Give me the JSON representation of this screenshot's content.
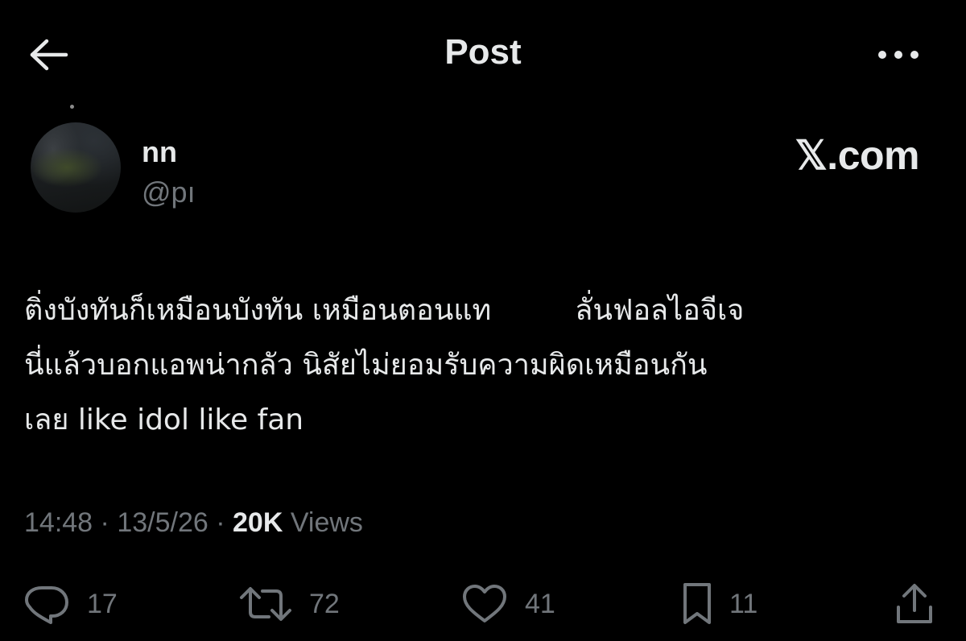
{
  "header": {
    "title": "Post",
    "back_icon": "arrow-left-icon",
    "more_icon": "more-horizontal-icon"
  },
  "post": {
    "author": {
      "display_name": "nn",
      "handle": "@pı"
    },
    "watermark": "𝕏.com",
    "text_lines": [
      [
        "ติ่งบังทันก็เหมือนบังทัน เหมือนตอนแท",
        "ลั่นฟอลไอจีเจ"
      ],
      [
        "นี่แล้วบอกแอพน่ากลัว นิสัยไม่ยอมรับความผิดเหมือนกัน"
      ],
      [
        "เลย like idol like fan"
      ]
    ],
    "time": "14:48",
    "date": "13/5/26",
    "separator": "·",
    "views_count": "20K",
    "views_label": "Views"
  },
  "actions": {
    "replies": "17",
    "reposts": "72",
    "likes": "41",
    "bookmarks": "11"
  },
  "colors": {
    "background": "#000000",
    "primary_text": "#e7e9ea",
    "secondary_text": "#71767b"
  }
}
